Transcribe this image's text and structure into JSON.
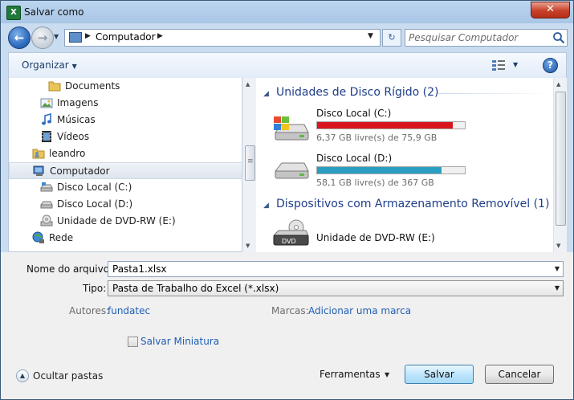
{
  "window": {
    "title": "Salvar como",
    "app_icon_letter": "X",
    "close_glyph": "✕"
  },
  "nav": {
    "back_glyph": "←",
    "forward_glyph": "→",
    "recent_glyph": "▼",
    "address": "Computador",
    "sep_glyph": "▶",
    "drop_glyph": "▼",
    "refresh_glyph": "↻",
    "search_placeholder": "Pesquisar Computador"
  },
  "toolbar": {
    "organize_label": "Organizar",
    "caret": "▼",
    "help_glyph": "?"
  },
  "nav_pane": {
    "items": [
      {
        "label": "Documents",
        "icon": "folder-icon"
      },
      {
        "label": "Imagens",
        "icon": "pictures-icon"
      },
      {
        "label": "Músicas",
        "icon": "music-icon"
      },
      {
        "label": "Vídeos",
        "icon": "video-icon"
      },
      {
        "label": "leandro",
        "icon": "user-icon"
      },
      {
        "label": "Computador",
        "icon": "computer-icon",
        "selected": true
      },
      {
        "label": "Disco Local (C:)",
        "icon": "drive-icon"
      },
      {
        "label": "Disco Local (D:)",
        "icon": "drive-icon"
      },
      {
        "label": "Unidade de DVD-RW (E:)",
        "icon": "dvd-icon"
      },
      {
        "label": "Rede",
        "icon": "network-icon"
      }
    ]
  },
  "content": {
    "group1": "Unidades de Disco Rígido (2)",
    "group2": "Dispositivos com Armazenamento Removível (1)",
    "caret": "◢",
    "drives": [
      {
        "name": "Disco Local (C:)",
        "free": "6,37 GB livre(s) de 75,9 GB",
        "used_fraction": 0.916,
        "bar_color": "#d9161e"
      },
      {
        "name": "Disco Local (D:)",
        "free": "58,1 GB livre(s) de 367 GB",
        "used_fraction": 0.842,
        "bar_color": "#2a9ec0"
      }
    ],
    "dvd": {
      "name": "Unidade de DVD-RW (E:)",
      "badge": "DVD"
    }
  },
  "form": {
    "filename_label": "Nome do arquivo:",
    "filename_value": "Pasta1.xlsx",
    "type_label": "Tipo:",
    "type_value": "Pasta de Trabalho do Excel (*.xlsx)",
    "authors_label": "Autores:",
    "authors_value": "fundatec",
    "tags_label": "Marcas:",
    "tags_value": "Adicionar uma marca",
    "thumbnail_label": "Salvar Miniatura",
    "hide_folders_label": "Ocultar pastas",
    "hide_glyph": "▲",
    "tools_label": "Ferramentas",
    "save_label": "Salvar",
    "cancel_label": "Cancelar"
  },
  "scroll": {
    "up": "▲",
    "down": "▼",
    "grip": "≡"
  }
}
